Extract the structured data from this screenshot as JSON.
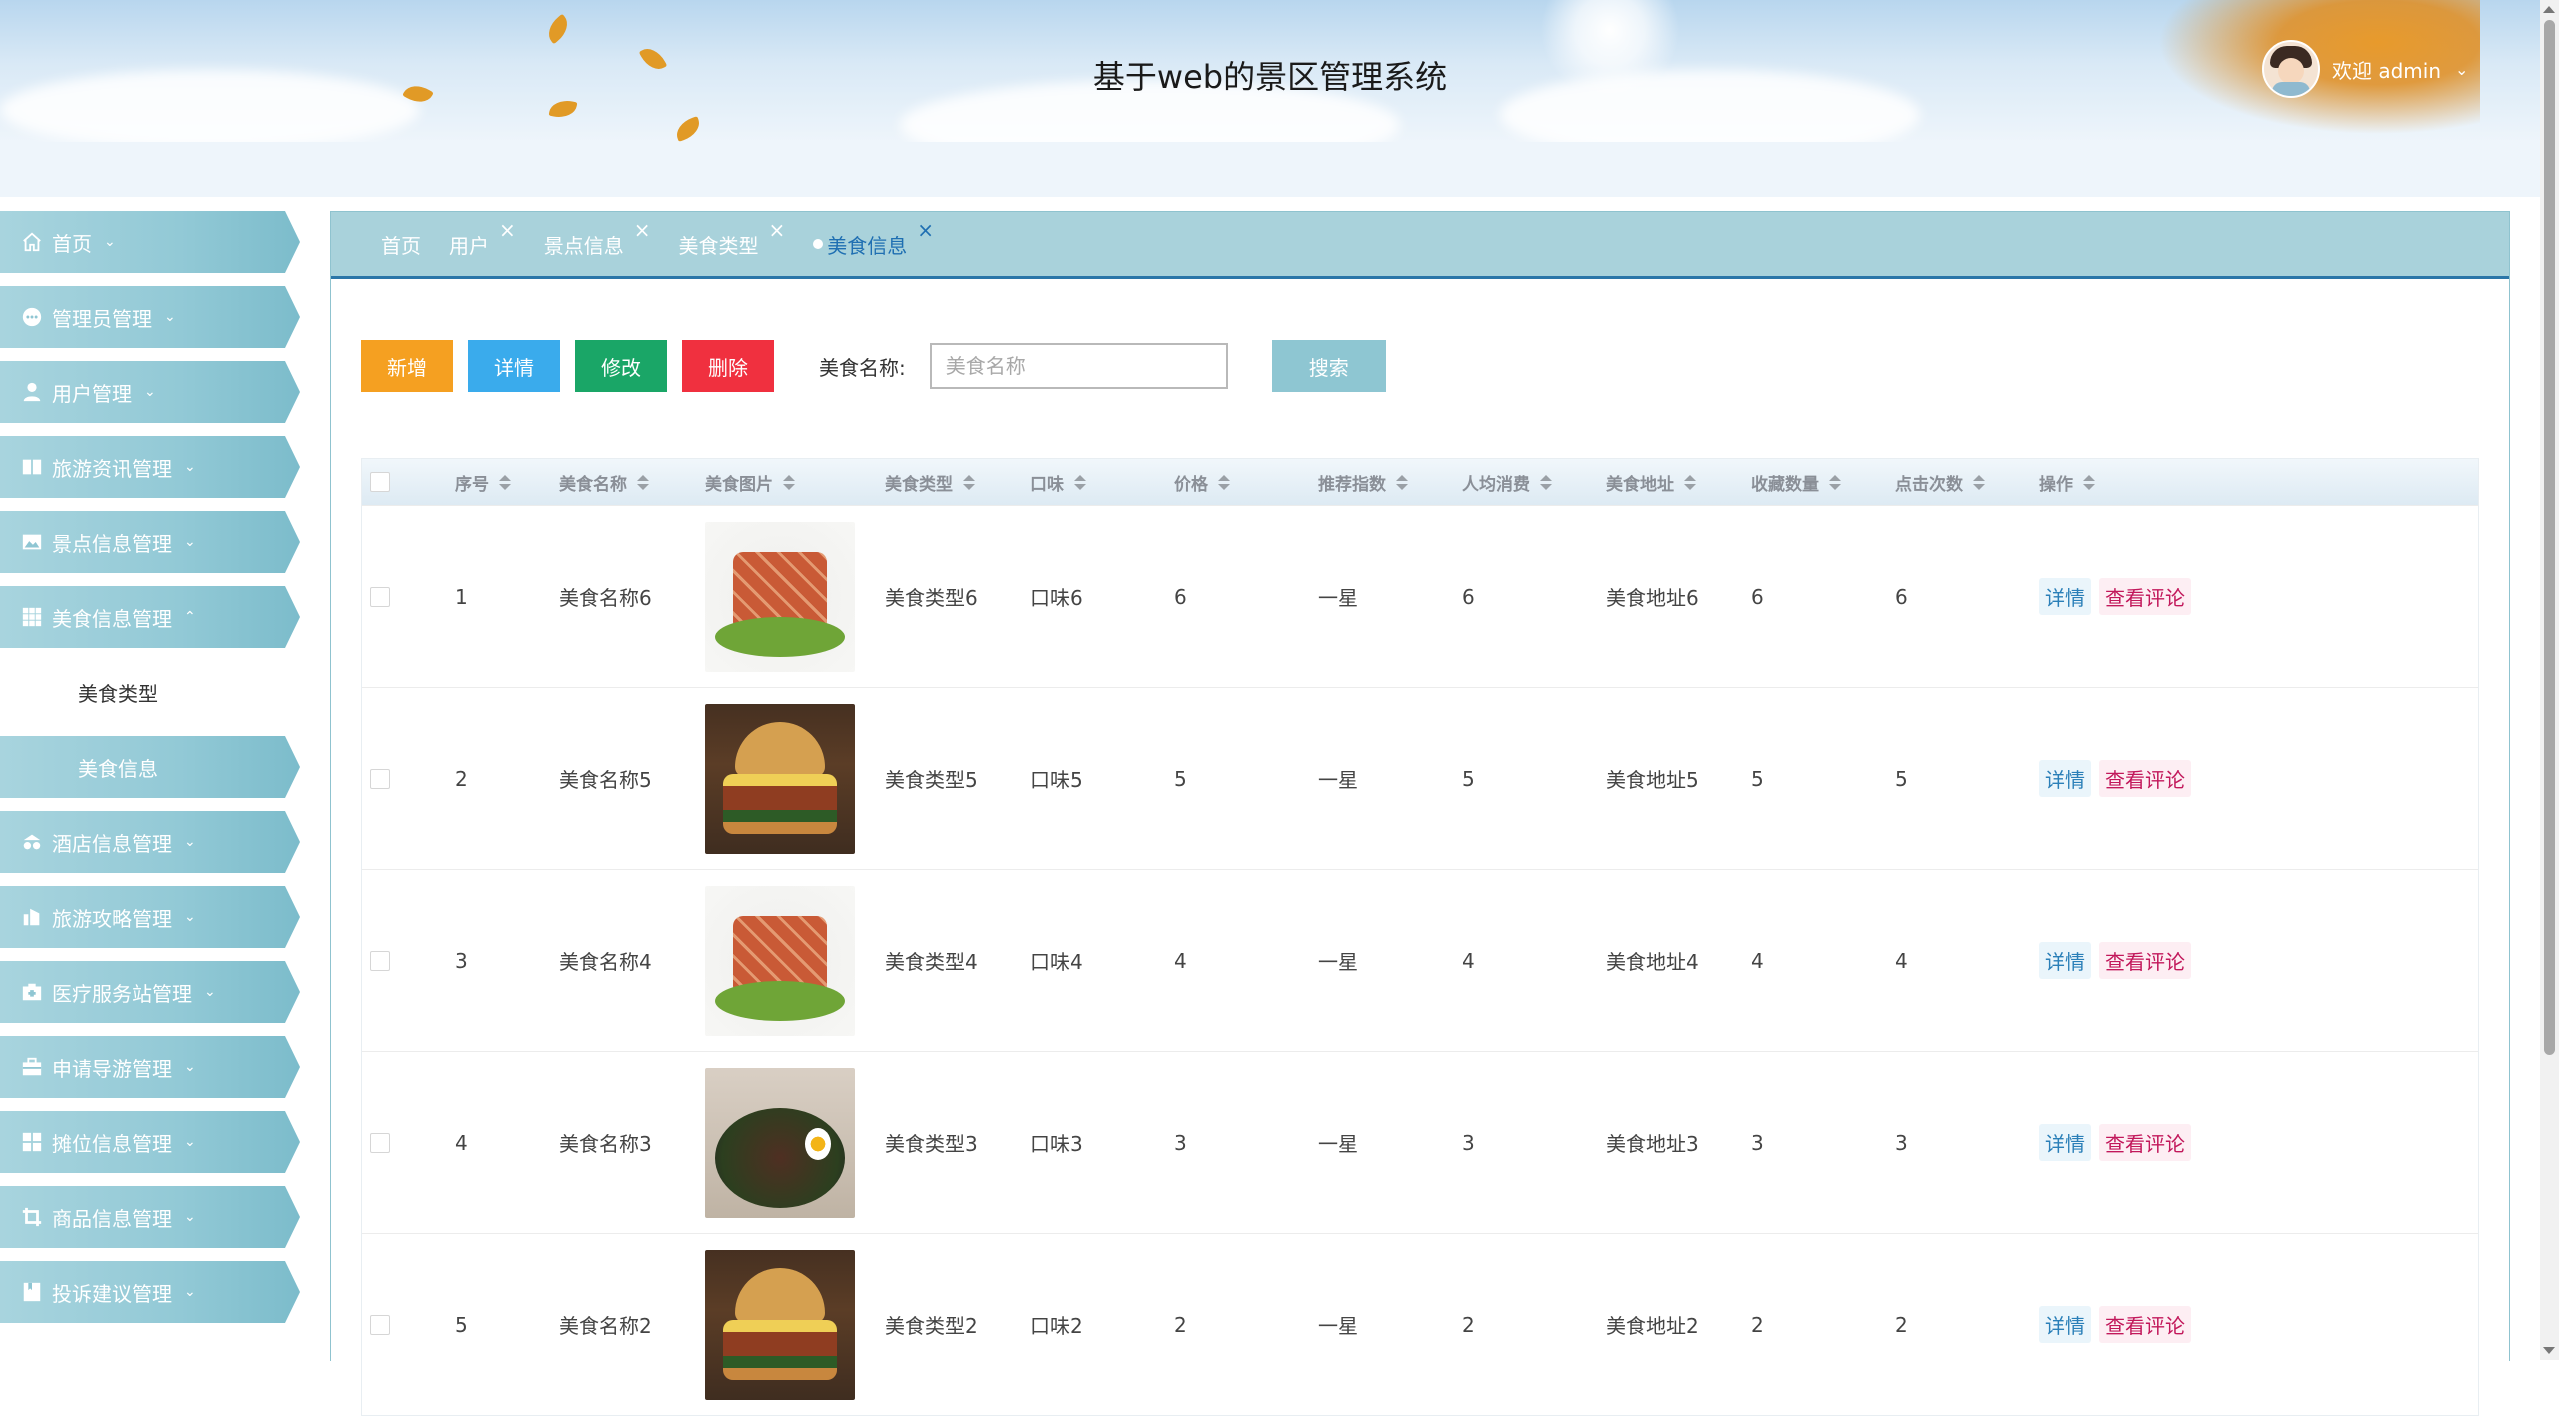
{
  "header": {
    "title": "基于web的景区管理系统",
    "welcome": "欢迎 admin"
  },
  "sidebar": {
    "items": [
      {
        "label": "首页",
        "icon": "home-icon"
      },
      {
        "label": "管理员管理",
        "icon": "chat-icon"
      },
      {
        "label": "用户管理",
        "icon": "user-icon"
      },
      {
        "label": "旅游资讯管理",
        "icon": "news-icon"
      },
      {
        "label": "景点信息管理",
        "icon": "picture-icon"
      },
      {
        "label": "美食信息管理",
        "icon": "grid-icon",
        "expanded": true
      },
      {
        "label": "酒店信息管理",
        "icon": "hotel-icon"
      },
      {
        "label": "旅游攻略管理",
        "icon": "strategy-icon"
      },
      {
        "label": "医疗服务站管理",
        "icon": "medical-icon"
      },
      {
        "label": "申请导游管理",
        "icon": "briefcase-icon"
      },
      {
        "label": "摊位信息管理",
        "icon": "apps-icon"
      },
      {
        "label": "商品信息管理",
        "icon": "crop-icon"
      },
      {
        "label": "投诉建议管理",
        "icon": "book-icon"
      }
    ],
    "subitems": [
      "美食类型",
      "美食信息"
    ]
  },
  "tabs": [
    "首页",
    "用户",
    "景点信息",
    "美食类型",
    "美食信息"
  ],
  "toolbar": {
    "add": "新增",
    "detail": "详情",
    "edit": "修改",
    "delete": "删除",
    "search_label": "美食名称:",
    "search_placeholder": "美食名称",
    "search_button": "搜索"
  },
  "table": {
    "headers": [
      "序号",
      "美食名称",
      "美食图片",
      "美食类型",
      "口味",
      "价格",
      "推荐指数",
      "人均消费",
      "美食地址",
      "收藏数量",
      "点击次数",
      "操作"
    ],
    "rows": [
      [
        "1",
        "美食名称6",
        "meat",
        "美食类型6",
        "口味6",
        "6",
        "一星",
        "6",
        "美食地址6",
        "6",
        "6"
      ],
      [
        "2",
        "美食名称5",
        "burger",
        "美食类型5",
        "口味5",
        "5",
        "一星",
        "5",
        "美食地址5",
        "5",
        "5"
      ],
      [
        "3",
        "美食名称4",
        "meat",
        "美食类型4",
        "口味4",
        "4",
        "一星",
        "4",
        "美食地址4",
        "4",
        "4"
      ],
      [
        "4",
        "美食名称3",
        "bowl",
        "美食类型3",
        "口味3",
        "3",
        "一星",
        "3",
        "美食地址3",
        "3",
        "3"
      ],
      [
        "5",
        "美食名称2",
        "burger",
        "美食类型2",
        "口味2",
        "2",
        "一星",
        "2",
        "美食地址2",
        "2",
        "2"
      ]
    ],
    "op_detail": "详情",
    "op_comment": "查看评论"
  }
}
